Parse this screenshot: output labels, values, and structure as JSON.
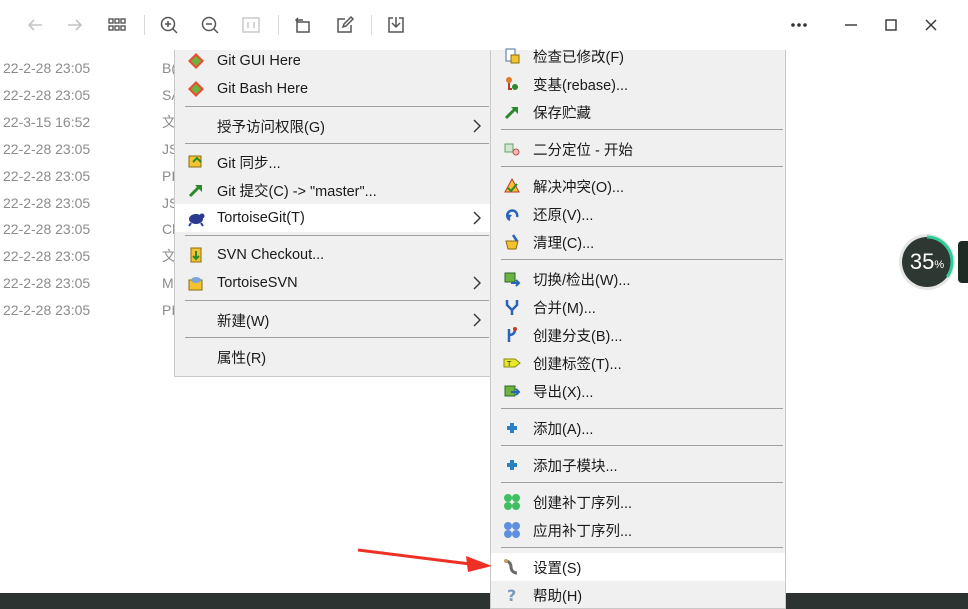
{
  "colors": {
    "menu_bg": "#f0f0f0",
    "highlight": "#ffffff",
    "annotation_arrow": "#ee3124",
    "gauge_bg": "#2d3833",
    "gauge_accent": "#2ecc9a",
    "bottom_strip": "#2c3330"
  },
  "toolbar": {
    "icons": [
      "back-arrow-icon",
      "forward-arrow-icon",
      "grid-view-icon",
      "zoom-in-icon",
      "zoom-out-icon",
      "fit-icon",
      "rotate-icon",
      "edit-icon",
      "download-icon",
      "more-icon",
      "minimize-icon",
      "maximize-icon",
      "close-icon"
    ]
  },
  "background_rows": [
    {
      "date": "22-2-28 23:05",
      "name": "B("
    },
    {
      "date": "22-2-28 23:05",
      "name": "SA"
    },
    {
      "date": "22-3-15 16:52",
      "name": "文"
    },
    {
      "date": "22-2-28 23:05",
      "name": "JS"
    },
    {
      "date": "22-2-28 23:05",
      "name": "PI"
    },
    {
      "date": "22-2-28 23:05",
      "name": "JS"
    },
    {
      "date": "22-2-28 23:05",
      "name": "Cl"
    },
    {
      "date": "22-2-28 23:05",
      "name": "文"
    },
    {
      "date": "22-2-28 23:05",
      "name": "M"
    },
    {
      "date": "22-2-28 23:05",
      "name": "PI"
    }
  ],
  "gauge": {
    "value": "35",
    "unit": "%",
    "progress": 0.35
  },
  "main_menu": {
    "items": [
      {
        "label": "Git GUI Here",
        "icon": "git-gui-icon",
        "submenu": false
      },
      {
        "label": "Git Bash Here",
        "icon": "git-bash-icon",
        "submenu": false
      },
      {
        "label": "授予访问权限(G)",
        "icon": "",
        "submenu": true
      },
      {
        "label": "Git 同步...",
        "icon": "git-sync-icon",
        "submenu": false
      },
      {
        "label": "Git 提交(C) -> \"master\"...",
        "icon": "git-commit-icon",
        "submenu": false
      },
      {
        "label": "TortoiseGit(T)",
        "icon": "tortoisegit-icon",
        "submenu": true,
        "highlighted": true
      },
      {
        "label": "SVN Checkout...",
        "icon": "svn-checkout-icon",
        "submenu": false
      },
      {
        "label": "TortoiseSVN",
        "icon": "tortoisesvn-icon",
        "submenu": true
      },
      {
        "label": "新建(W)",
        "icon": "",
        "submenu": true
      },
      {
        "label": "属性(R)",
        "icon": "",
        "submenu": false
      }
    ]
  },
  "sub_menu": {
    "items": [
      {
        "label": "检查已修改(F)",
        "icon": "check-modified-icon"
      },
      {
        "label": "变基(rebase)...",
        "icon": "rebase-icon"
      },
      {
        "label": "保存贮藏",
        "icon": "stash-save-icon"
      },
      {
        "label": "二分定位 - 开始",
        "icon": "bisect-icon"
      },
      {
        "label": "解决冲突(O)...",
        "icon": "resolve-conflict-icon"
      },
      {
        "label": "还原(V)...",
        "icon": "revert-icon"
      },
      {
        "label": "清理(C)...",
        "icon": "cleanup-icon"
      },
      {
        "label": "切换/检出(W)...",
        "icon": "switch-checkout-icon"
      },
      {
        "label": "合并(M)...",
        "icon": "merge-icon"
      },
      {
        "label": "创建分支(B)...",
        "icon": "create-branch-icon"
      },
      {
        "label": "创建标签(T)...",
        "icon": "create-tag-icon"
      },
      {
        "label": "导出(X)...",
        "icon": "export-icon"
      },
      {
        "label": "添加(A)...",
        "icon": "add-icon"
      },
      {
        "label": "添加子模块...",
        "icon": "add-submodule-icon"
      },
      {
        "label": "创建补丁序列...",
        "icon": "create-patch-icon"
      },
      {
        "label": "应用补丁序列...",
        "icon": "apply-patch-icon"
      },
      {
        "label": "设置(S)",
        "icon": "settings-icon",
        "highlighted": true
      },
      {
        "label": "帮助(H)",
        "icon": "help-icon"
      }
    ]
  }
}
